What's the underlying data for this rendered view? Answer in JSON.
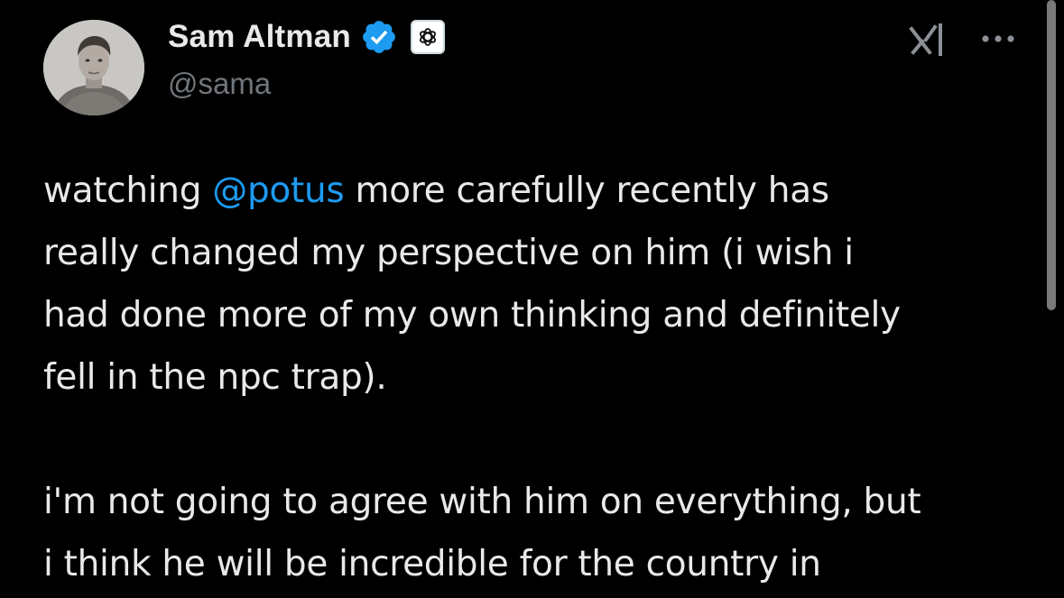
{
  "author": {
    "display_name": "Sam Altman",
    "handle": "@sama",
    "verified_icon": "verified-badge-icon",
    "affiliate_icon": "openai-logo-icon"
  },
  "header_actions": {
    "grok_icon": "grok-icon",
    "more_icon": "more-options-icon"
  },
  "tweet": {
    "line1_a": "watching ",
    "line1_mention": "@potus",
    "line1_b": " more carefully recently has",
    "line2": "really changed my perspective on him (i wish i",
    "line3": "had done more of my own thinking and definitely",
    "line4": "fell in the npc trap).",
    "line5": "i'm not going to agree with him on everything, but",
    "line6": "i think he will be incredible for the country in"
  },
  "colors": {
    "background": "#000000",
    "text": "#e7e9ea",
    "secondary_text": "#71767b",
    "link": "#1d9bf0",
    "verified": "#1d9bf0"
  }
}
